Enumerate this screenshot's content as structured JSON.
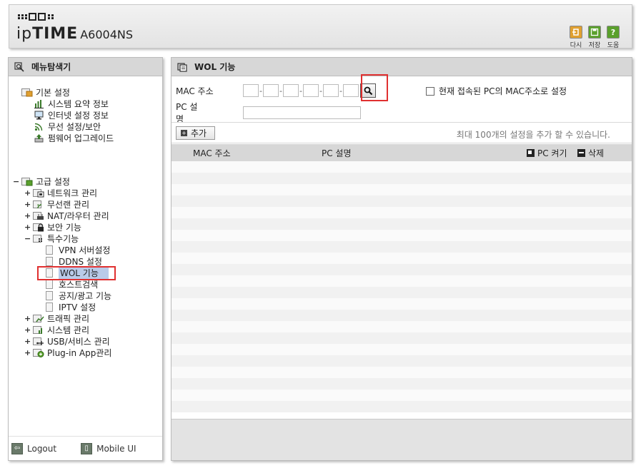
{
  "header": {
    "brand_prefix": "ip",
    "brand_time": "TIME",
    "model": "A6004NS",
    "buttons": [
      {
        "label": "다시",
        "icon": "refresh-icon",
        "color": "#e0a030"
      },
      {
        "label": "저장",
        "icon": "save-icon",
        "color": "#5aa02c"
      },
      {
        "label": "도움",
        "icon": "help-icon",
        "color": "#5aa02c"
      }
    ]
  },
  "sidebar": {
    "title": "메뉴탐색기",
    "basic": {
      "label": "기본 설정",
      "items": [
        "시스템 요약 정보",
        "인터넷 설정 정보",
        "무선 설정/보안",
        "펌웨어 업그레이드"
      ]
    },
    "advanced": {
      "label": "고급 설정",
      "groups": [
        {
          "label": "네트워크 관리",
          "icon": "network-icon"
        },
        {
          "label": "무선랜 관리",
          "icon": "wireless-icon"
        },
        {
          "label": "NAT/라우터 관리",
          "icon": "router-icon"
        },
        {
          "label": "보안 기능",
          "icon": "lock-icon"
        },
        {
          "label": "특수기능",
          "icon": "special-icon"
        }
      ],
      "special_items": [
        "VPN 서버설정",
        "DDNS 설정",
        "WOL 기능",
        "호스트검색",
        "공지/광고 기능",
        "IPTV 설정"
      ],
      "more_groups": [
        {
          "label": "트래픽 관리",
          "icon": "traffic-icon"
        },
        {
          "label": "시스템 관리",
          "icon": "system-icon"
        },
        {
          "label": "USB/서비스 관리",
          "icon": "usb-icon"
        },
        {
          "label": "Plug-in App관리",
          "icon": "plugin-icon"
        }
      ]
    },
    "footer": {
      "logout": "Logout",
      "mobile": "Mobile UI"
    }
  },
  "main": {
    "title": "WOL 기능",
    "mac_label": "MAC 주소",
    "pc_desc_label": "PC 설명",
    "current_pc_label": "현재 접속된 PC의 MAC주소로 설정",
    "add_label": "추가",
    "limit_note": "최대 100개의 설정을 추가 할 수 있습니다.",
    "columns": {
      "mac": "MAC 주소",
      "desc": "PC 설명",
      "power_on": "PC 켜기",
      "delete": "삭제"
    }
  }
}
